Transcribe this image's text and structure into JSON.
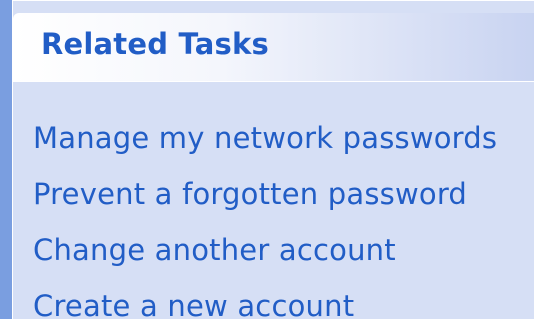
{
  "related_tasks": {
    "title": "Related Tasks",
    "items": [
      {
        "label": "Manage my network passwords"
      },
      {
        "label": "Prevent a forgotten password"
      },
      {
        "label": "Change another account"
      },
      {
        "label": "Create a new account"
      }
    ]
  },
  "colors": {
    "link": "#215dc6",
    "panel_background": "#d6dff5",
    "side_background": "#6d93db"
  }
}
